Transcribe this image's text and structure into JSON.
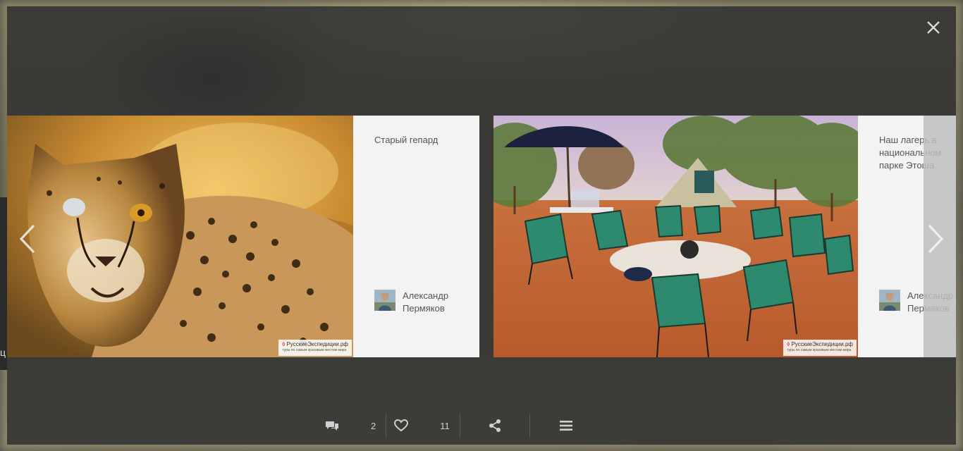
{
  "viewer": {
    "close_icon": "close-icon",
    "prev_icon": "chevron-left-icon",
    "next_icon": "chevron-right-icon"
  },
  "edge_glyph": "ц",
  "photos": [
    {
      "caption": "Старый гепард",
      "author": "Александр Пермяков",
      "watermark_main": "РусскиеЭкспедиции.рф",
      "watermark_sub": "туры по самым красивым местам мира"
    },
    {
      "caption": "Наш лагерь в национальном парке Этоша",
      "author": "Александр Пермяков",
      "watermark_main": "РусскиеЭкспедиции.рф",
      "watermark_sub": "туры по самым красивым местам мира"
    }
  ],
  "toolbar": {
    "comments_icon": "comments-icon",
    "comments_count": "2",
    "likes_icon": "heart-icon",
    "likes_count": "11",
    "share_icon": "share-icon",
    "menu_icon": "menu-icon"
  },
  "colors": {
    "panel": "#303030",
    "card": "#f3f3f3",
    "text_muted": "#555555",
    "toolbar_text": "#cfcfcf"
  }
}
